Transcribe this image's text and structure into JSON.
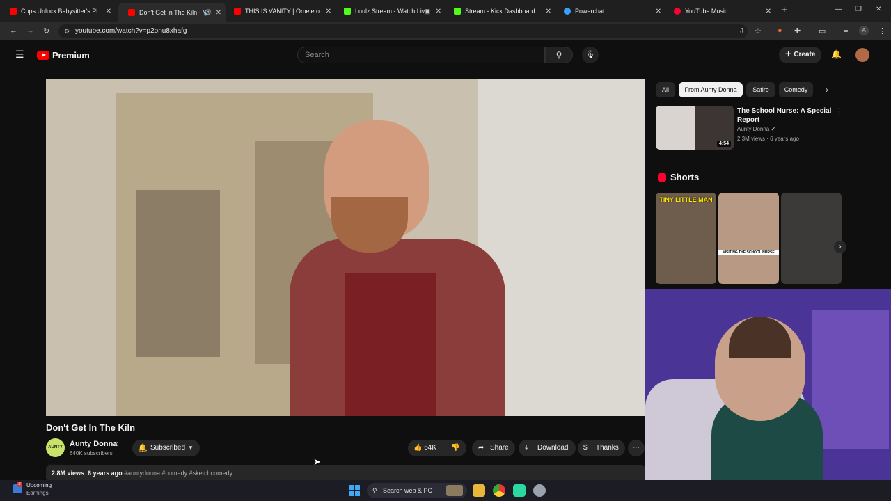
{
  "browser": {
    "tabs": [
      {
        "title": "Cops Unlock Babysitter's Phone",
        "favicon": "youtube",
        "color": "#ff0000"
      },
      {
        "title": "Don't Get In The Kiln - YouTube",
        "favicon": "youtube",
        "color": "#ff0000",
        "active": true
      },
      {
        "title": "THIS IS VANITY | Omeleto - YouTube",
        "favicon": "youtube",
        "color": "#ff0000"
      },
      {
        "title": "Loulz Stream - Watch Live on Kick",
        "favicon": "kick",
        "color": "#53fc18"
      },
      {
        "title": "Stream - Kick Dashboard",
        "favicon": "kick",
        "color": "#53fc18"
      },
      {
        "title": "Powerchat",
        "favicon": "powerchat",
        "color": "#3aa0ff"
      },
      {
        "title": "YouTube Music",
        "favicon": "youtube-music",
        "color": "#ff0033"
      }
    ],
    "new_tab": "+",
    "url": "youtube.com/watch?v=p2onu8xhafg",
    "profile_initial": "A"
  },
  "yt": {
    "logo_text": "Premium",
    "search_placeholder": "Search",
    "create_label": "Create"
  },
  "video": {
    "title": "Don't Get In The Kiln",
    "channel": "Aunty Donna",
    "channel_avatar_text": "AUNTY DONNA",
    "subscribers": "640K subscribers",
    "subscribed_label": "Subscribed",
    "likes": "64K",
    "share_label": "Share",
    "download_label": "Download",
    "thanks_label": "Thanks",
    "views": "2.8M views",
    "age": "6 years ago",
    "tags": "#auntydonna #comedy #sketchcomedy"
  },
  "sidebar": {
    "chips": [
      "All",
      "From Aunty Donna",
      "Satire",
      "Comedy"
    ],
    "selected_chip": "From Aunty Donna",
    "recommended": {
      "title": "The School Nurse: A Special Report",
      "channel": "Aunty Donna",
      "views": "2.3M views",
      "age": "6 years ago",
      "duration": "4:54"
    },
    "shorts_heading": "Shorts",
    "shorts": [
      {
        "caption": "TINY LITTLE MAN"
      },
      {
        "caption": "VISITING THE SCHOOL NURSE"
      },
      {
        "caption": ""
      }
    ]
  },
  "taskbar": {
    "widget_title": "Upcoming",
    "widget_subtitle": "Earnings",
    "widget_badge": "2",
    "search_label": "Search web & PC"
  }
}
